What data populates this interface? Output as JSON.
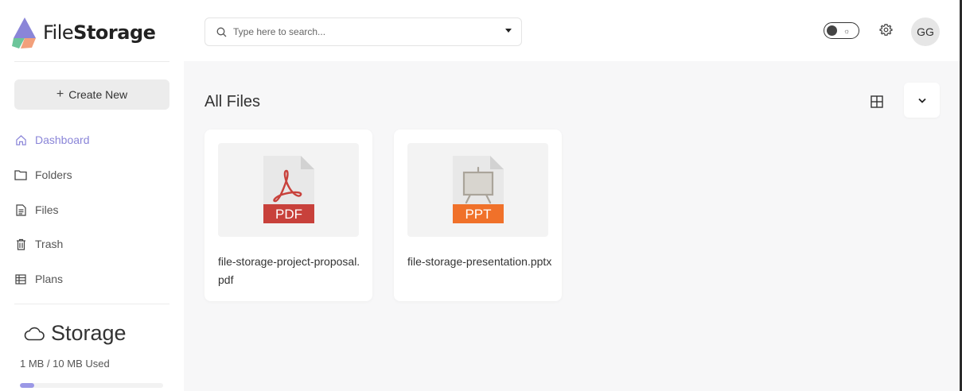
{
  "app": {
    "name_prefix": "File",
    "name_suffix": "Storage"
  },
  "sidebar": {
    "create_label": "Create New",
    "items": [
      {
        "label": "Dashboard",
        "icon": "home-icon",
        "active": true
      },
      {
        "label": "Folders",
        "icon": "folder-icon",
        "active": false
      },
      {
        "label": "Files",
        "icon": "file-icon",
        "active": false
      },
      {
        "label": "Trash",
        "icon": "trash-icon",
        "active": false
      },
      {
        "label": "Plans",
        "icon": "plans-icon",
        "active": false
      }
    ],
    "storage": {
      "title": "Storage",
      "used_text": "1 MB / 10 MB Used",
      "used_fraction": 0.1
    }
  },
  "header": {
    "search_placeholder": "Type here to search...",
    "avatar_initials": "GG"
  },
  "main": {
    "title": "All Files",
    "files": [
      {
        "name": "file-storage-project-proposal.pdf",
        "type_label": "PDF",
        "type_color": "#c8413b"
      },
      {
        "name": "file-storage-presentation.pptx",
        "type_label": "PPT",
        "type_color": "#f0712a"
      }
    ]
  },
  "colors": {
    "accent": "#8a85d8",
    "storage_fill": "#9b98e6"
  }
}
